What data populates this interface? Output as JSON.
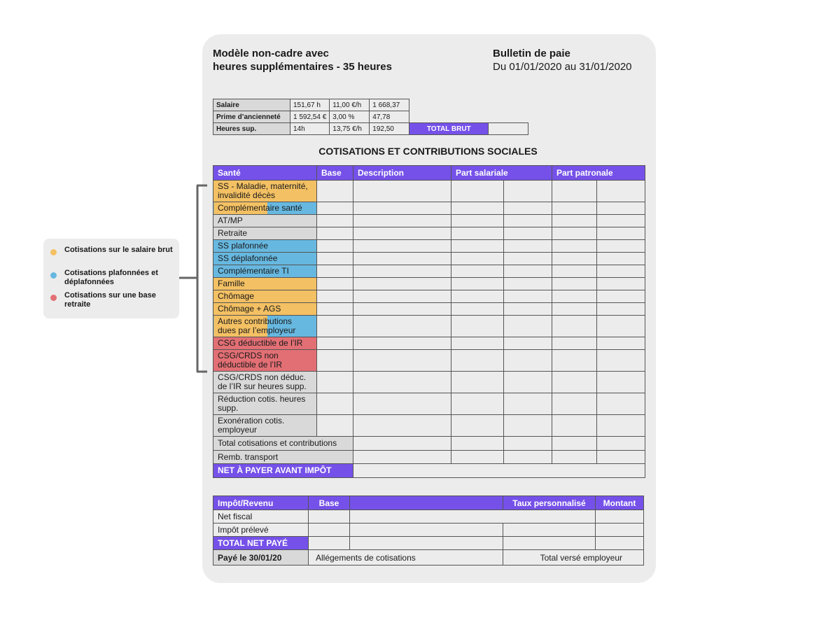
{
  "header": {
    "title_line1": "Modèle non-cadre avec",
    "title_line2": "heures supplémentaires - 35 heures",
    "bulletin_title": "Bulletin de paie",
    "bulletin_period": "Du 01/01/2020 au 31/01/2020"
  },
  "salary_table": {
    "rows": [
      {
        "label": "Salaire",
        "qty": "151,67 h",
        "rate": "11,00 €/h",
        "amount": "1 668,37"
      },
      {
        "label": "Prime d’ancienneté",
        "qty": "1 592,54 €",
        "rate": "3,00 %",
        "amount": "47,78"
      },
      {
        "label": "Heures sup.",
        "qty": "14h",
        "rate": "13,75 €/h",
        "amount": "192,50"
      }
    ],
    "total_label": "TOTAL BRUT"
  },
  "section_title": "COTISATIONS ET CONTRIBUTIONS SOCIALES",
  "contrib_table": {
    "headers": {
      "sante": "Santé",
      "base": "Base",
      "description": "Description",
      "salariale": "Part salariale",
      "patronale": "Part patronale"
    },
    "rows": [
      {
        "label": "SS - Maladie, maternité, invalidité décès",
        "category": "yellow"
      },
      {
        "label": "Complémentaire santé",
        "category": "split"
      },
      {
        "label": "AT/MP",
        "category": "grey"
      },
      {
        "label": "Retraite",
        "category": "grey"
      },
      {
        "label": "SS plafonnée",
        "category": "blue"
      },
      {
        "label": "SS déplafonnée",
        "category": "blue"
      },
      {
        "label": "Complémentaire TI",
        "category": "blue"
      },
      {
        "label": "Famille",
        "category": "yellow"
      },
      {
        "label": "Chômage",
        "category": "yellow"
      },
      {
        "label": "Chômage + AGS",
        "category": "yellow"
      },
      {
        "label": "Autres contributions dues par l’employeur",
        "category": "split"
      },
      {
        "label": "CSG déductible de l’IR",
        "category": "red"
      },
      {
        "label": "CSG/CRDS non déductible de l’IR",
        "category": "red"
      },
      {
        "label": "CSG/CRDS non déduc. de l’IR sur heures supp.",
        "category": "grey"
      },
      {
        "label": "Réduction cotis. heures supp.",
        "category": "grey"
      },
      {
        "label": "Exonération cotis. employeur",
        "category": "grey"
      }
    ],
    "total_contrib": "Total cotisations et contributions",
    "remb_transport": "Remb. transport",
    "net_avant_impot": "NET À PAYER AVANT IMPÔT"
  },
  "impot_table": {
    "headers": {
      "impot": "Impôt/Revenu",
      "base": "Base",
      "taux": "Taux personnalisé",
      "montant": "Montant"
    },
    "net_fiscal": "Net fiscal",
    "impot_preleve": "Impôt prélevé",
    "total_net": "TOTAL NET PAYÉ",
    "paye_le": "Payé le 30/01/20",
    "allegements": "Allégements de cotisations",
    "total_verse": "Total versé employeur"
  },
  "legend": {
    "items": [
      {
        "label": "Cotisations sur le salaire brut",
        "color": "#f3c063"
      },
      {
        "label": "Cotisations plafonnées et déplafonnées",
        "color": "#67b8e0"
      },
      {
        "label": "Cotisations sur une base retraite",
        "color": "#e26f74"
      }
    ]
  },
  "colors": {
    "accent": "#7551e9",
    "yellow": "#f3c063",
    "blue": "#67b8e0",
    "red": "#e26f74",
    "grey": "#d9d9d9",
    "card": "#ececec"
  }
}
